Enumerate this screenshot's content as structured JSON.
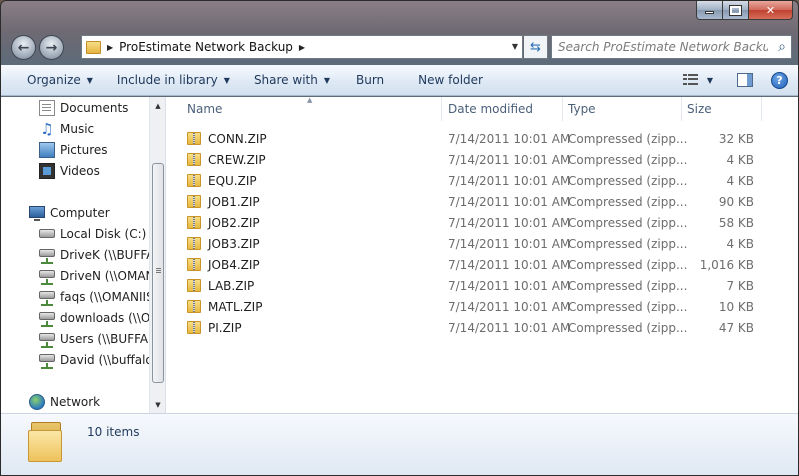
{
  "window": {
    "minimize_glyph": "",
    "close_glyph": "✕"
  },
  "address": {
    "breadcrumb_arrow": "▶",
    "path_label": "ProEstimate Network Backup",
    "trailing_arrow": "▶",
    "dropdown_arrow": "▼"
  },
  "search": {
    "placeholder": "Search ProEstimate Network Backup"
  },
  "toolbar": {
    "organize": "Organize",
    "include_in_library": "Include in library",
    "share_with": "Share with",
    "burn": "Burn",
    "new_folder": "New folder",
    "dropdown_glyph": "▼",
    "help_glyph": "?"
  },
  "navpane": {
    "items": [
      {
        "label": "Documents",
        "icon": "documents-icon"
      },
      {
        "label": "Music",
        "icon": "music-icon"
      },
      {
        "label": "Pictures",
        "icon": "pictures-icon"
      },
      {
        "label": "Videos",
        "icon": "videos-icon"
      },
      {
        "label": "Computer",
        "icon": "computer-icon"
      },
      {
        "label": "Local Disk (C:)",
        "icon": "local-disk-icon"
      },
      {
        "label": "DriveK (\\\\BUFFAL",
        "icon": "network-drive-icon"
      },
      {
        "label": "DriveN (\\\\OMAN",
        "icon": "network-drive-icon"
      },
      {
        "label": "faqs (\\\\OMANIIS)",
        "icon": "network-drive-icon"
      },
      {
        "label": "downloads (\\\\OM",
        "icon": "network-drive-icon"
      },
      {
        "label": "Users (\\\\BUFFALC",
        "icon": "network-drive-icon"
      },
      {
        "label": "David (\\\\buffalo\\",
        "icon": "network-drive-icon"
      },
      {
        "label": "Network",
        "icon": "network-icon"
      }
    ]
  },
  "columns": {
    "name": "Name",
    "date_modified": "Date modified",
    "type": "Type",
    "size": "Size"
  },
  "files": [
    {
      "name": "CONN.ZIP",
      "date": "7/14/2011 10:01 AM",
      "type": "Compressed (zipp...",
      "size": "32 KB"
    },
    {
      "name": "CREW.ZIP",
      "date": "7/14/2011 10:01 AM",
      "type": "Compressed (zipp...",
      "size": "4 KB"
    },
    {
      "name": "EQU.ZIP",
      "date": "7/14/2011 10:01 AM",
      "type": "Compressed (zipp...",
      "size": "4 KB"
    },
    {
      "name": "JOB1.ZIP",
      "date": "7/14/2011 10:01 AM",
      "type": "Compressed (zipp...",
      "size": "90 KB"
    },
    {
      "name": "JOB2.ZIP",
      "date": "7/14/2011 10:01 AM",
      "type": "Compressed (zipp...",
      "size": "58 KB"
    },
    {
      "name": "JOB3.ZIP",
      "date": "7/14/2011 10:01 AM",
      "type": "Compressed (zipp...",
      "size": "4 KB"
    },
    {
      "name": "JOB4.ZIP",
      "date": "7/14/2011 10:01 AM",
      "type": "Compressed (zipp...",
      "size": "1,016 KB"
    },
    {
      "name": "LAB.ZIP",
      "date": "7/14/2011 10:01 AM",
      "type": "Compressed (zipp...",
      "size": "7 KB"
    },
    {
      "name": "MATL.ZIP",
      "date": "7/14/2011 10:01 AM",
      "type": "Compressed (zipp...",
      "size": "10 KB"
    },
    {
      "name": "PI.ZIP",
      "date": "7/14/2011 10:01 AM",
      "type": "Compressed (zipp...",
      "size": "47 KB"
    }
  ],
  "status": {
    "item_count": "10 items"
  }
}
